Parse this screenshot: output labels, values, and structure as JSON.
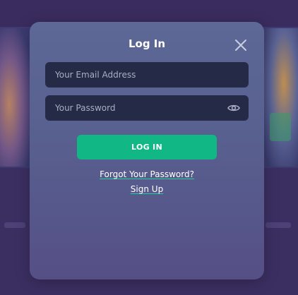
{
  "modal": {
    "title": "Log In",
    "close_icon": "close-icon"
  },
  "form": {
    "email": {
      "value": "",
      "placeholder": "Your Email Address"
    },
    "password": {
      "value": "",
      "placeholder": "Your Password",
      "toggle_icon": "eye-icon"
    },
    "login_label": "LOG IN"
  },
  "links": {
    "forgot_password": "Forgot Your Password?",
    "sign_up": "Sign Up"
  },
  "colors": {
    "accent": "#11b886",
    "input_background": "#252a46",
    "modal_background": "#5a6491",
    "page_background": "#3a2c5e"
  }
}
